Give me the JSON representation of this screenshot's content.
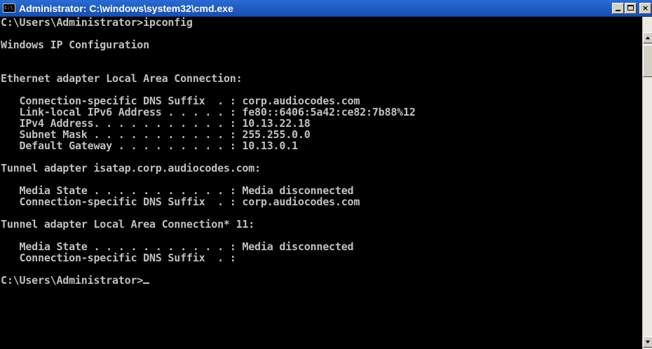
{
  "window": {
    "title": "Administrator: C:\\windows\\system32\\cmd.exe",
    "icon_text": "c:\\",
    "controls": {
      "minimize": "minimize-icon",
      "maximize": "maximize-icon",
      "close_label": "×"
    }
  },
  "console": {
    "lines": [
      "C:\\Users\\Administrator>ipconfig",
      "",
      "Windows IP Configuration",
      "",
      "",
      "Ethernet adapter Local Area Connection:",
      "",
      "   Connection-specific DNS Suffix  . : corp.audiocodes.com",
      "   Link-local IPv6 Address . . . . . : fe80::6406:5a42:ce82:7b88%12",
      "   IPv4 Address. . . . . . . . . . . : 10.13.22.18",
      "   Subnet Mask . . . . . . . . . . . : 255.255.0.0",
      "   Default Gateway . . . . . . . . . : 10.13.0.1",
      "",
      "Tunnel adapter isatap.corp.audiocodes.com:",
      "",
      "   Media State . . . . . . . . . . . : Media disconnected",
      "   Connection-specific DNS Suffix  . : corp.audiocodes.com",
      "",
      "Tunnel adapter Local Area Connection* 11:",
      "",
      "   Media State . . . . . . . . . . . : Media disconnected",
      "   Connection-specific DNS Suffix  . :",
      "",
      "C:\\Users\\Administrator>"
    ]
  },
  "colors": {
    "console_bg": "#000000",
    "console_fg": "#c0c0c0",
    "titlebar": "#1f5ec6"
  }
}
